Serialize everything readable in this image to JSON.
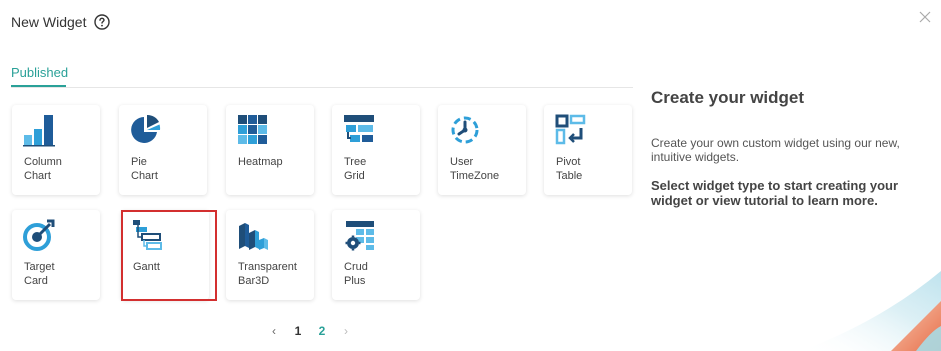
{
  "header": {
    "title": "New Widget",
    "help_icon": "question-circle-icon",
    "close_icon": "close-icon"
  },
  "tabs": [
    {
      "label": "Published",
      "active": true
    }
  ],
  "widgets": [
    {
      "label": "Column\nChart",
      "icon": "column-chart-icon"
    },
    {
      "label": "Pie\nChart",
      "icon": "pie-chart-icon"
    },
    {
      "label": "Heatmap",
      "icon": "heatmap-icon"
    },
    {
      "label": "Tree\nGrid",
      "icon": "tree-grid-icon"
    },
    {
      "label": "User\nTimeZone",
      "icon": "timezone-icon"
    },
    {
      "label": "Pivot\nTable",
      "icon": "pivot-table-icon"
    },
    {
      "label": "Target\nCard",
      "icon": "target-card-icon"
    },
    {
      "label": "Gantt",
      "icon": "gantt-icon",
      "highlighted": true
    },
    {
      "label": "Transparent\nBar3D",
      "icon": "bar3d-icon"
    },
    {
      "label": "Crud\nPlus",
      "icon": "crud-plus-icon"
    }
  ],
  "pagination": {
    "prev": "‹",
    "pages": [
      "1",
      "2"
    ],
    "current": "2",
    "next": "›"
  },
  "side": {
    "title": "Create your widget",
    "description": "Create your own custom widget using our new, intuitive widgets.",
    "instruction": "Select widget type to start creating your widget or view tutorial to learn more."
  },
  "colors": {
    "accent": "#2aa198",
    "icon_dark": "#1f4e79",
    "icon_light": "#2e9fd8",
    "highlight": "#d32f2f"
  }
}
